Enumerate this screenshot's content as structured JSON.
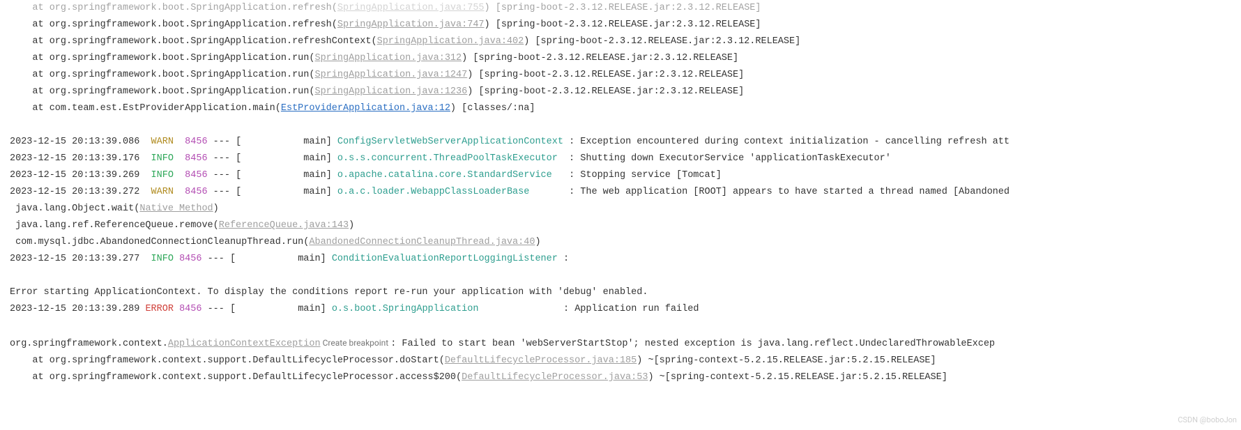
{
  "stack_top": [
    {
      "prefix": "    at org.springframework.boot.SpringApplication.refresh(",
      "link": "SpringApplication.java:755",
      "suffix": ") [spring-boot-2.3.12.RELEASE.jar:2.3.12.RELEASE]"
    },
    {
      "prefix": "    at org.springframework.boot.SpringApplication.refresh(",
      "link": "SpringApplication.java:747",
      "suffix": ") [spring-boot-2.3.12.RELEASE.jar:2.3.12.RELEASE]"
    },
    {
      "prefix": "    at org.springframework.boot.SpringApplication.refreshContext(",
      "link": "SpringApplication.java:402",
      "suffix": ") [spring-boot-2.3.12.RELEASE.jar:2.3.12.RELEASE]"
    },
    {
      "prefix": "    at org.springframework.boot.SpringApplication.run(",
      "link": "SpringApplication.java:312",
      "suffix": ") [spring-boot-2.3.12.RELEASE.jar:2.3.12.RELEASE]"
    },
    {
      "prefix": "    at org.springframework.boot.SpringApplication.run(",
      "link": "SpringApplication.java:1247",
      "suffix": ") [spring-boot-2.3.12.RELEASE.jar:2.3.12.RELEASE]"
    },
    {
      "prefix": "    at org.springframework.boot.SpringApplication.run(",
      "link": "SpringApplication.java:1236",
      "suffix": ") [spring-boot-2.3.12.RELEASE.jar:2.3.12.RELEASE]"
    }
  ],
  "stack_top_last": {
    "prefix": "    at com.team.est.EstProviderApplication.main(",
    "link": "EstProviderApplication.java:12",
    "suffix": ") [classes/:na]"
  },
  "log_lines": [
    {
      "ts": "2023-12-15 20:13:39.086",
      "level": "WARN",
      "level_cls": "warn",
      "pid": "8456",
      "thread": " --- [           main] ",
      "cls": "ConfigServletWebServerApplicationContext",
      "msg": " : Exception encountered during context initialization - cancelling refresh att"
    },
    {
      "ts": "2023-12-15 20:13:39.176",
      "level": "INFO",
      "level_cls": "info",
      "pid": "8456",
      "thread": " --- [           main] ",
      "cls": "o.s.s.concurrent.ThreadPoolTaskExecutor",
      "msg": "  : Shutting down ExecutorService 'applicationTaskExecutor'"
    },
    {
      "ts": "2023-12-15 20:13:39.269",
      "level": "INFO",
      "level_cls": "info",
      "pid": "8456",
      "thread": " --- [           main] ",
      "cls": "o.apache.catalina.core.StandardService",
      "msg": "   : Stopping service [Tomcat]"
    },
    {
      "ts": "2023-12-15 20:13:39.272",
      "level": "WARN",
      "level_cls": "warn",
      "pid": "8456",
      "thread": " --- [           main] ",
      "cls": "o.a.c.loader.WebappClassLoaderBase",
      "msg": "       : The web application [ROOT] appears to have started a thread named [Abandoned"
    }
  ],
  "mid_stack": [
    {
      "prefix": " java.lang.Object.wait(",
      "link": "Native Method",
      "suffix": ")"
    },
    {
      "prefix": " java.lang.ref.ReferenceQueue.remove(",
      "link": "ReferenceQueue.java:143",
      "suffix": ")"
    },
    {
      "prefix": " com.mysql.jdbc.AbandonedConnectionCleanupThread.run(",
      "link": "AbandonedConnectionCleanupThread.java:40",
      "suffix": ")"
    }
  ],
  "cond_line": {
    "ts": "2023-12-15 20:13:39.277",
    "level": "INFO",
    "level_cls": "info",
    "pid": "8456",
    "thread": " --- [           main] ",
    "cls": "ConditionEvaluationReportLoggingListener",
    "msg": " : "
  },
  "error_intro": "Error starting ApplicationContext. To display the conditions report re-run your application with 'debug' enabled.",
  "error_line": {
    "ts": "2023-12-15 20:13:39.289",
    "level": "ERROR",
    "level_cls": "error",
    "pid": "8456",
    "thread": " --- [           main] ",
    "cls": "o.s.boot.SpringApplication",
    "msg": "               : Application run failed"
  },
  "exception_line": {
    "prefix": "org.springframework.context.",
    "ex_link": "ApplicationContextException",
    "bp": " Create breakpoint ",
    "msg": ": Failed to start bean 'webServerStartStop'; nested exception is java.lang.reflect.UndeclaredThrowableExcep"
  },
  "stack_bottom": [
    {
      "prefix": "    at org.springframework.context.support.DefaultLifecycleProcessor.doStart(",
      "link": "DefaultLifecycleProcessor.java:185",
      "suffix": ") ~[spring-context-5.2.15.RELEASE.jar:5.2.15.RELEASE]"
    },
    {
      "prefix": "    at org.springframework.context.support.DefaultLifecycleProcessor.access$200(",
      "link": "DefaultLifecycleProcessor.java:53",
      "suffix": ") ~[spring-context-5.2.15.RELEASE.jar:5.2.15.RELEASE]"
    }
  ],
  "watermark": "CSDN @boboJon"
}
